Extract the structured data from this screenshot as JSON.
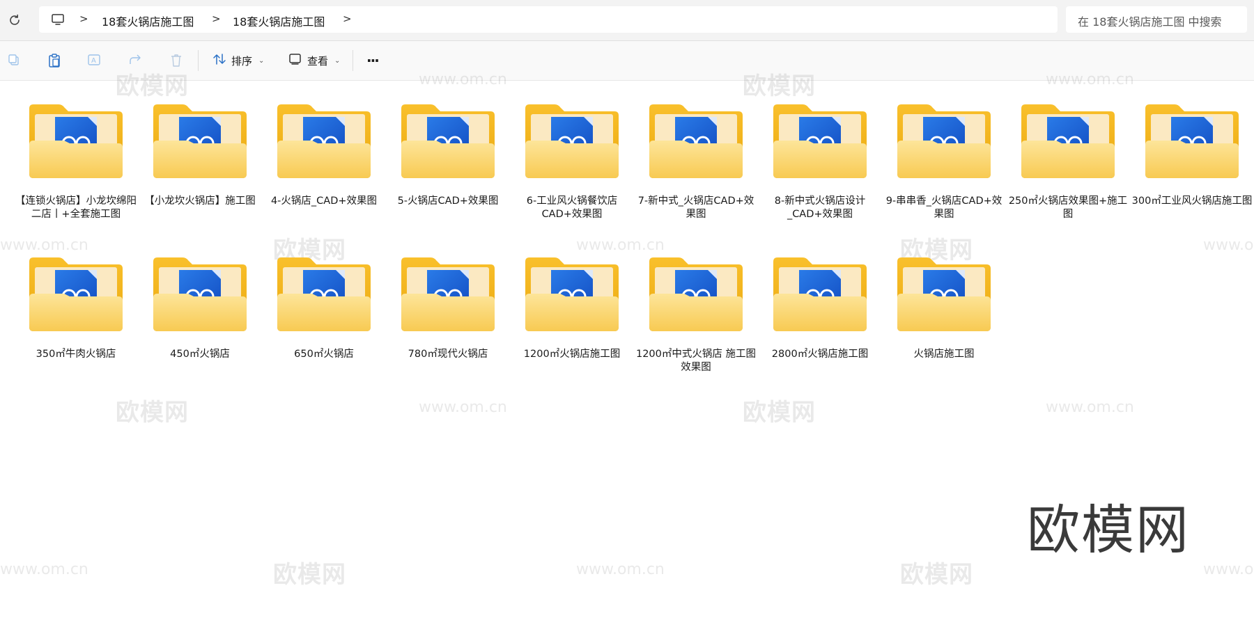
{
  "address_bar": {
    "breadcrumbs": [
      "18套火锅店施工图",
      "18套火锅店施工图"
    ],
    "search_placeholder": "在 18套火锅店施工图 中搜索"
  },
  "toolbar": {
    "sort_label": "排序",
    "view_label": "查看",
    "more_label": "···"
  },
  "folders": [
    {
      "name": "【连锁火锅店】小龙坎绵阳二店丨+全套施工图"
    },
    {
      "name": "【小龙坎火锅店】施工图"
    },
    {
      "name": "4-火锅店_CAD+效果图"
    },
    {
      "name": "5-火锅店CAD+效果图"
    },
    {
      "name": "6-工业风火锅餐饮店CAD+效果图"
    },
    {
      "name": "7-新中式_火锅店CAD+效果图"
    },
    {
      "name": "8-新中式火锅店设计_CAD+效果图"
    },
    {
      "name": "9-串串香_火锅店CAD+效果图"
    },
    {
      "name": "250㎡火锅店效果图+施工图"
    },
    {
      "name": "300㎡工业风火锅店施工图"
    },
    {
      "name": "350㎡牛肉火锅店"
    },
    {
      "name": "450㎡火锅店"
    },
    {
      "name": "650㎡火锅店"
    },
    {
      "name": "780㎡现代火锅店"
    },
    {
      "name": "1200㎡火锅店施工图"
    },
    {
      "name": "1200㎡中式火锅店 施工图 效果图"
    },
    {
      "name": "2800㎡火锅店施工图"
    },
    {
      "name": "火锅店施工图"
    }
  ],
  "watermarks": {
    "logo_text": "欧模网",
    "url_text": "www.om.cn",
    "big_text": "欧模网"
  },
  "colors": {
    "folder_back": "#f3b619",
    "folder_front": "#fcd77a",
    "file_blue": "#1f63d8",
    "accent": "#0067c0"
  }
}
